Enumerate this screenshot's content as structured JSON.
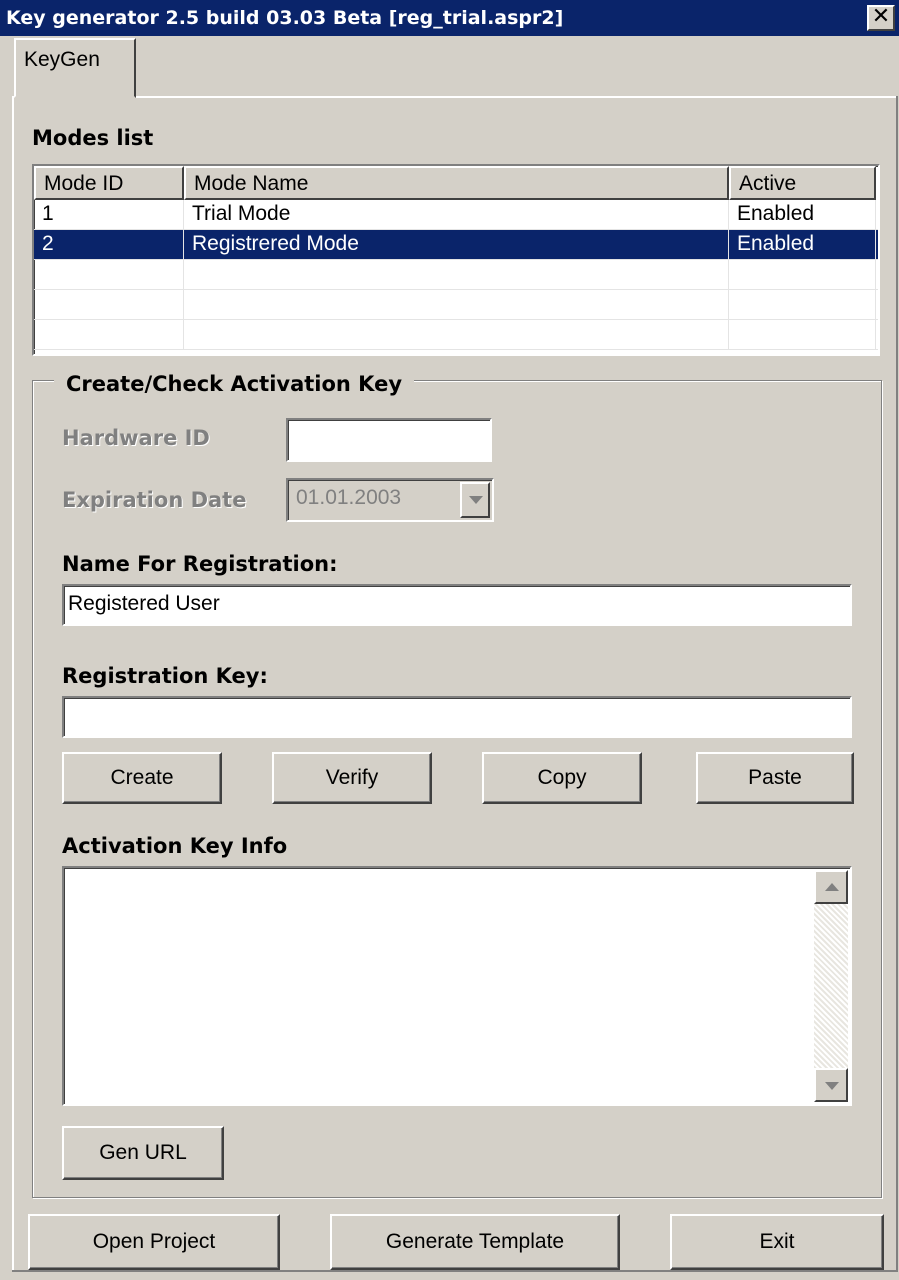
{
  "window": {
    "title": "Key generator 2.5 build 03.03 Beta [reg_trial.aspr2]",
    "close_glyph": "✕"
  },
  "tab": {
    "label": "KeyGen"
  },
  "modes": {
    "title": "Modes list",
    "columns": [
      "Mode ID",
      "Mode Name",
      "Active"
    ],
    "rows": [
      {
        "id": "1",
        "name": "Trial Mode",
        "active": "Enabled"
      },
      {
        "id": "2",
        "name": "Registrered Mode",
        "active": "Enabled"
      }
    ],
    "selected_index": 1
  },
  "activation": {
    "group_title": "Create/Check Activation Key",
    "hardware_id_label": "Hardware ID",
    "hardware_id_value": "",
    "expiration_label": "Expiration Date",
    "expiration_value": "01.01.2003",
    "name_label": "Name For Registration:",
    "name_value": "Registered User",
    "key_label": "Registration Key:",
    "key_value": "",
    "buttons": {
      "create": "Create",
      "verify": "Verify",
      "copy": "Copy",
      "paste": "Paste"
    },
    "info_label": "Activation Key Info",
    "info_value": "",
    "gen_url": "Gen URL"
  },
  "footer": {
    "open_project": "Open Project",
    "generate_template": "Generate Template",
    "exit": "Exit"
  },
  "colors": {
    "titlebar": "#0a246a",
    "face": "#d4d0c8",
    "selection": "#0a246a"
  }
}
